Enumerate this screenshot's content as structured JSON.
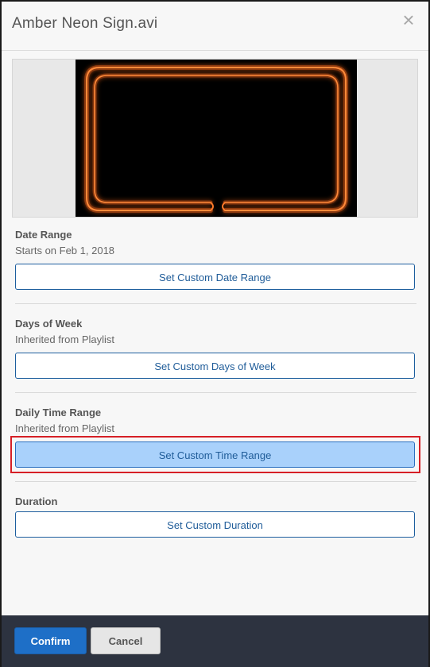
{
  "dialog": {
    "title": "Amber Neon Sign.avi",
    "close_icon": "close-icon"
  },
  "preview": {
    "content": "amber neon sign thumbnail",
    "neon_color": "#ff6a1a"
  },
  "sections": [
    {
      "label": "Date Range",
      "status": "Starts on Feb 1, 2018",
      "button": "Set Custom Date Range"
    },
    {
      "label": "Days of Week",
      "status": "Inherited from Playlist",
      "button": "Set Custom Days of Week"
    },
    {
      "label": "Daily Time Range",
      "status": "Inherited from Playlist",
      "button": "Set Custom Time Range"
    },
    {
      "label": "Duration",
      "button": "Set Custom Duration"
    }
  ],
  "footer": {
    "confirm_label": "Confirm",
    "cancel_label": "Cancel"
  },
  "colors": {
    "accent": "#1e6fc7",
    "active_button": "#a9d1fb",
    "highlight_border": "#d61f26",
    "footer_bg": "#2d3340"
  }
}
